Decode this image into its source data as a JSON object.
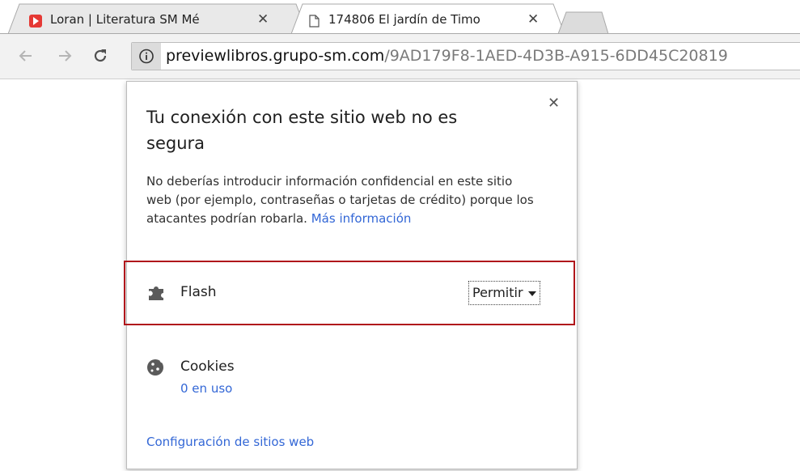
{
  "tabs": [
    {
      "title": "Loran | Literatura SM Mé",
      "favicon": "red-play-icon",
      "active": false
    },
    {
      "title": "174806 El jardín de Timo",
      "favicon": "page-icon",
      "active": true
    }
  ],
  "toolbar": {
    "url_domain": "previewlibros.grupo-sm.com",
    "url_path": "/9AD179F8-1AED-4D3B-A915-6DD45C20819"
  },
  "popup": {
    "title": "Tu conexión con este sitio web no es segura",
    "body": "No deberías introducir información confidencial en este sitio web (por ejemplo, contraseñas o tarjetas de crédito) porque los atacantes podrían robarla.",
    "more_info_link": "Más información",
    "permissions": [
      {
        "name": "Flash",
        "icon": "puzzle-icon",
        "value": "Permitir"
      }
    ],
    "cookies": {
      "label": "Cookies",
      "count_text": "0 en uso"
    },
    "site_settings_link": "Configuración de sitios web"
  },
  "colors": {
    "link": "#3367d6",
    "highlight_border": "#b0161b",
    "toolbar_bg": "#f2f2f2"
  }
}
